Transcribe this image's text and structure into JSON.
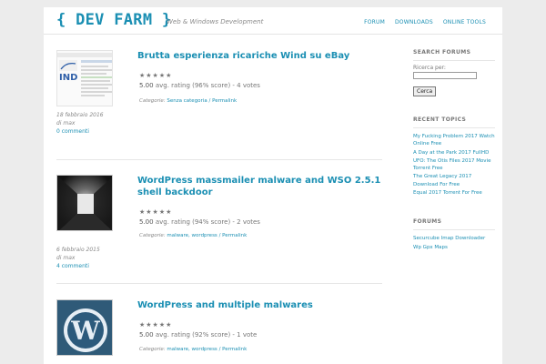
{
  "header": {
    "logo": "{ DEV FARM }",
    "tagline": "Web & Windows Development",
    "nav": [
      "FORUM",
      "DOWNLOADS",
      "ONLINE TOOLS"
    ]
  },
  "posts": [
    {
      "title": "Brutta esperienza ricariche Wind su eBay",
      "stars": "★★★★★",
      "rating_value": "5.00",
      "rating_text": "avg. rating (96% score) - 4 votes",
      "rating_fraction": 0.96,
      "categories_label": "Categorie:",
      "categories": "Senza categoria",
      "permalink": "/ Permalink",
      "date": "18 febbraio 2016",
      "author": "di max",
      "comments": "0 commenti",
      "thumb_text": "IND"
    },
    {
      "title": "WordPress massmailer malware and WSO 2.5.1 shell backdoor",
      "stars": "★★★★★",
      "rating_value": "5.00",
      "rating_text": "avg. rating (94% score) - 2 votes",
      "rating_fraction": 0.94,
      "categories_label": "Categorie:",
      "categories": "malware, wordpress",
      "permalink": "/ Permalink",
      "date": "6 febbraio 2015",
      "author": "di max",
      "comments": "4 commenti"
    },
    {
      "title": "WordPress and multiple malwares",
      "stars": "★★★★★",
      "rating_value": "5.00",
      "rating_text": "avg. rating (92% score) - 1 vote",
      "rating_fraction": 0.92,
      "categories_label": "Categorie:",
      "categories": "malware, wordpress",
      "permalink": "/ Permalink"
    }
  ],
  "sidebar": {
    "search": {
      "title": "SEARCH FORUMS",
      "label": "Ricerca per:",
      "value": "",
      "button": "Cerca"
    },
    "recent": {
      "title": "RECENT TOPICS",
      "items": [
        "My Fucking Problem 2017 Watch Online Free",
        "A Day at the Park 2017 FullHD",
        "UFO: The Otis Files 2017 Movie Torrent Free",
        "The Great Legacy 2017 Download For Free",
        "Equal 2017 Torrent For Free"
      ]
    },
    "forums": {
      "title": "FORUMS",
      "items": [
        "Securcube Imap Downloader",
        "Wp Gpx Maps"
      ]
    }
  },
  "colors": {
    "accent": "#1b8fb3",
    "page_bg": "#ececec",
    "card_bg": "#ffffff"
  }
}
